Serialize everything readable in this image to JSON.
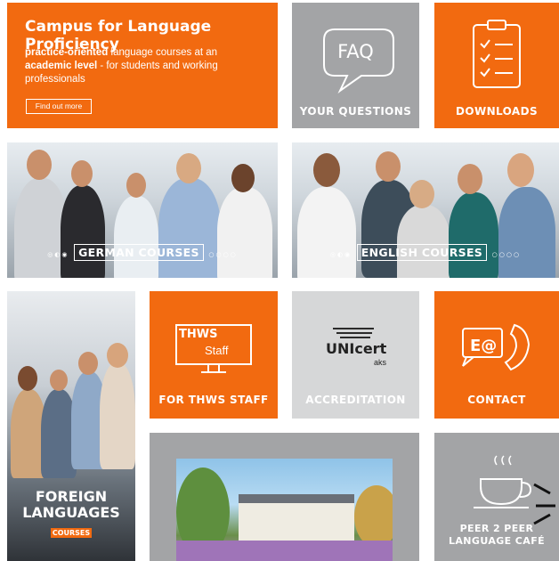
{
  "hero": {
    "title": "Campus for Language Proficiency",
    "desc_bold1": "practice-oriented",
    "desc_part1": " language courses at an ",
    "desc_bold2": "academic level",
    "desc_part2": " - for students and working professionals",
    "button_label": "Find out more"
  },
  "faq": {
    "icon_text": "FAQ",
    "caption": "YOUR QUESTIONS"
  },
  "downloads": {
    "caption": "DOWNLOADS"
  },
  "german": {
    "caption": "GERMAN COURSES"
  },
  "english": {
    "caption": "ENGLISH COURSES"
  },
  "foreign": {
    "line1": "FOREIGN",
    "line2": "LANGUAGES",
    "sub": "COURSES"
  },
  "staff": {
    "screen_title": "THWS",
    "screen_sub": "Staff",
    "caption": "FOR THWS STAFF"
  },
  "accreditation": {
    "logo_main": "UNIcert",
    "logo_sub": "aks",
    "caption": "ACCREDITATION"
  },
  "contact": {
    "caption": "CONTACT"
  },
  "cafe": {
    "line1": "PEER 2 PEER",
    "line2": "LANGUAGE CAFÉ"
  },
  "colors": {
    "orange": "#f26a10",
    "grey": "#a3a4a6",
    "light_grey": "#d6d7d8"
  }
}
